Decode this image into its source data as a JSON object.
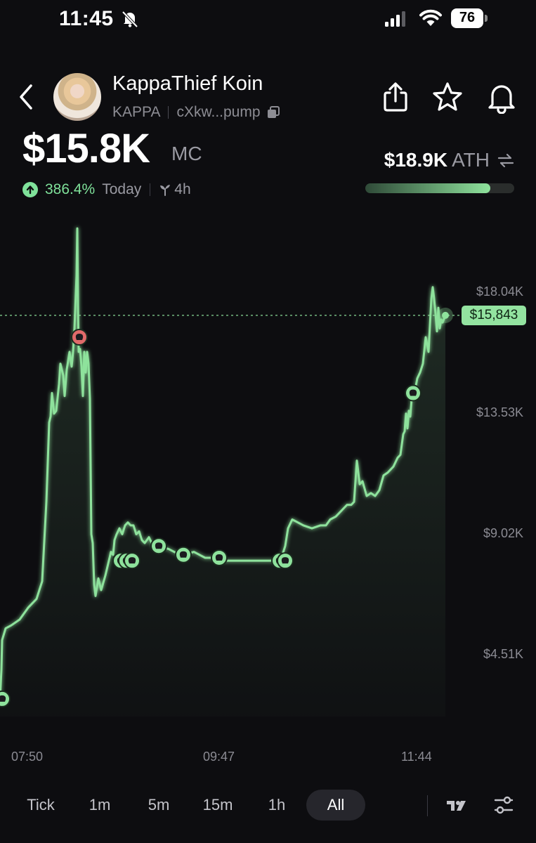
{
  "status_bar": {
    "time": "11:45",
    "battery": "76"
  },
  "token": {
    "name": "KappaThief Koin",
    "ticker": "KAPPA",
    "address": "cXkw...pump"
  },
  "market_cap": {
    "value": "$15.8K",
    "label": "MC"
  },
  "change": {
    "percent": "386.4%",
    "period": "Today",
    "age": "4h"
  },
  "ath": {
    "value": "$18.9K",
    "label": "ATH",
    "progress": 0.84
  },
  "chart_data": {
    "type": "line",
    "x_ticks": [
      "07:50",
      "09:47",
      "11:44"
    ],
    "y_ticks": [
      "$18.04K",
      "$13.53K",
      "$9.02K",
      "$4.51K"
    ],
    "current_price_label": "$15,843",
    "current_price": 15843,
    "ylim": [
      2200,
      19400
    ],
    "x": [
      0,
      2,
      3,
      8,
      16,
      28,
      40,
      52,
      60,
      66,
      70,
      72,
      74,
      77,
      80,
      84,
      86,
      88,
      90,
      92,
      95,
      97,
      99,
      102,
      104,
      106,
      108,
      109,
      110,
      111,
      112,
      114,
      116,
      118,
      120,
      122,
      124,
      126,
      128,
      130,
      132,
      134,
      136,
      138,
      140,
      144,
      150,
      155,
      158,
      161,
      163,
      166,
      170,
      174,
      178,
      182,
      186,
      190,
      194,
      198,
      202,
      206,
      212,
      218,
      226,
      240,
      256,
      262,
      276,
      292,
      308,
      312,
      320,
      330,
      336,
      350,
      370,
      385,
      396,
      402,
      406,
      410,
      416,
      424,
      432,
      444,
      456,
      464,
      470,
      478,
      486,
      494,
      500,
      504,
      508,
      512,
      516,
      522,
      528,
      534,
      540,
      546,
      552,
      560,
      566,
      570,
      574,
      576,
      578,
      580,
      582,
      584,
      586,
      590,
      594,
      598,
      602,
      606,
      610,
      612,
      614,
      616,
      618,
      620,
      622,
      624,
      626,
      628,
      630,
      634
    ],
    "y": [
      2800,
      3800,
      4800,
      5200,
      5300,
      5500,
      5900,
      6200,
      6800,
      9500,
      12200,
      12400,
      13200,
      12500,
      12600,
      13500,
      14200,
      14000,
      13800,
      13100,
      14000,
      14300,
      14600,
      14100,
      14600,
      15400,
      16600,
      17200,
      18800,
      16200,
      14600,
      14700,
      14100,
      13100,
      14600,
      13900,
      14600,
      14200,
      13000,
      8400,
      8100,
      6700,
      6300,
      6600,
      6900,
      6500,
      7000,
      7500,
      7800,
      7700,
      8200,
      8400,
      8600,
      8400,
      8700,
      8800,
      8700,
      8700,
      8400,
      8500,
      8200,
      8100,
      8300,
      8000,
      8000,
      7900,
      7700,
      7700,
      7800,
      7600,
      7600,
      7500,
      7500,
      7500,
      7500,
      7500,
      7500,
      7500,
      7500,
      7700,
      8000,
      8600,
      8900,
      8800,
      8700,
      8600,
      8700,
      8700,
      8900,
      9000,
      9200,
      9400,
      9400,
      9500,
      10900,
      10100,
      10200,
      9700,
      9800,
      9700,
      9900,
      10400,
      10500,
      10700,
      11000,
      11100,
      11800,
      11900,
      12500,
      12000,
      12600,
      12400,
      13000,
      13200,
      13700,
      13900,
      14200,
      15100,
      14600,
      15500,
      16400,
      16800,
      16400,
      15900,
      15300,
      16100,
      15400,
      15700,
      15600,
      15843
    ],
    "trades": [
      {
        "x": 3,
        "y": 2800,
        "side": "buy"
      },
      {
        "x": 113,
        "y": 15100,
        "side": "sell"
      },
      {
        "x": 172,
        "y": 7500,
        "side": "buy"
      },
      {
        "x": 180,
        "y": 7500,
        "side": "buy"
      },
      {
        "x": 188,
        "y": 7500,
        "side": "buy"
      },
      {
        "x": 226,
        "y": 8000,
        "side": "buy"
      },
      {
        "x": 261,
        "y": 7700,
        "side": "buy"
      },
      {
        "x": 312,
        "y": 7600,
        "side": "buy"
      },
      {
        "x": 398,
        "y": 7500,
        "side": "buy"
      },
      {
        "x": 406,
        "y": 7500,
        "side": "buy"
      },
      {
        "x": 588,
        "y": 13200,
        "side": "buy"
      }
    ],
    "colors": {
      "line": "#8ee29c",
      "buy": "#8ee29c",
      "sell": "#e06a6a",
      "tag": "#93e3a0"
    }
  },
  "timeframes": [
    "Tick",
    "1m",
    "5m",
    "15m",
    "1h",
    "All"
  ],
  "active_timeframe": "All"
}
